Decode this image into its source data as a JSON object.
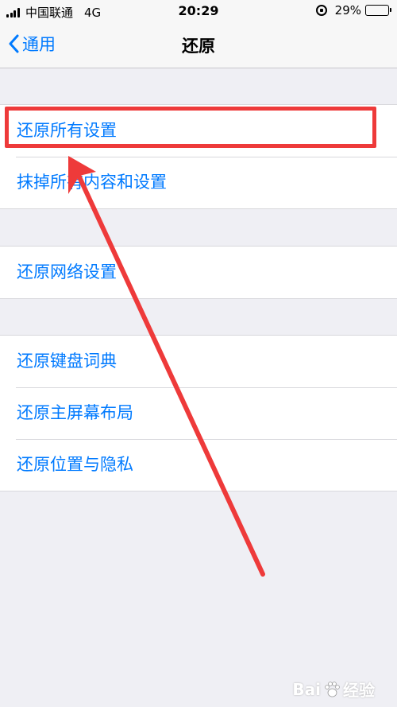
{
  "status_bar": {
    "carrier": "中国联通",
    "network": "4G",
    "time": "20:29",
    "battery": "29%",
    "battery_level": 0.29
  },
  "nav": {
    "back_label": "通用",
    "title": "还原"
  },
  "groups": [
    {
      "items": [
        "还原所有设置",
        "抹掉所有内容和设置"
      ]
    },
    {
      "items": [
        "还原网络设置"
      ]
    },
    {
      "items": [
        "还原键盘词典",
        "还原主屏幕布局",
        "还原位置与隐私"
      ]
    }
  ],
  "watermark": {
    "left": "Bai",
    "right": "经验"
  },
  "colors": {
    "accent": "#007aff",
    "annotation": "#ee3a3a",
    "background": "#efeff4"
  }
}
